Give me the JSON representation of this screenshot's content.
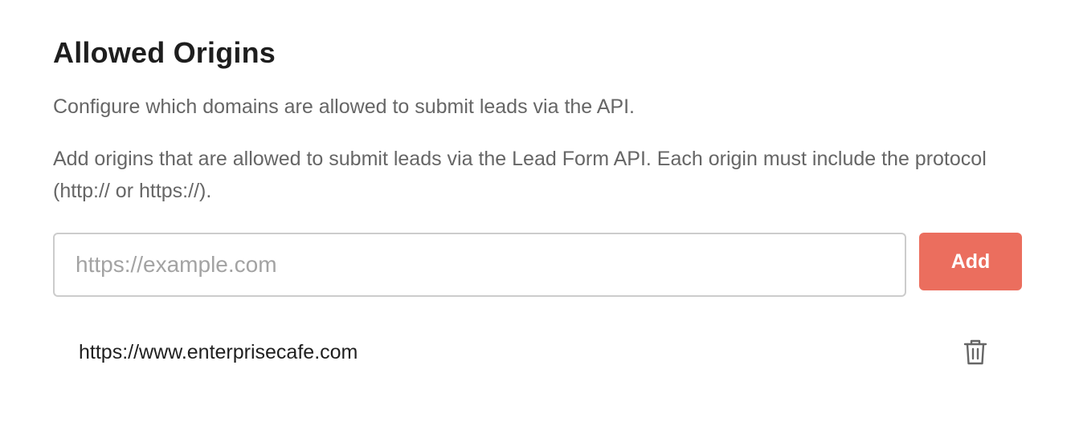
{
  "section": {
    "title": "Allowed Origins",
    "subtitle": "Configure which domains are allowed to submit leads via the API.",
    "help_text": "Add origins that are allowed to submit leads via the Lead Form API. Each origin must include the protocol (http:// or https://)."
  },
  "form": {
    "input_placeholder": "https://example.com",
    "input_value": "",
    "add_label": "Add"
  },
  "origins": [
    {
      "url": "https://www.enterprisecafe.com",
      "icon": "trash-icon"
    }
  ],
  "colors": {
    "accent": "#eb6e5e",
    "muted_text": "#666666",
    "border": "#cccccc"
  }
}
